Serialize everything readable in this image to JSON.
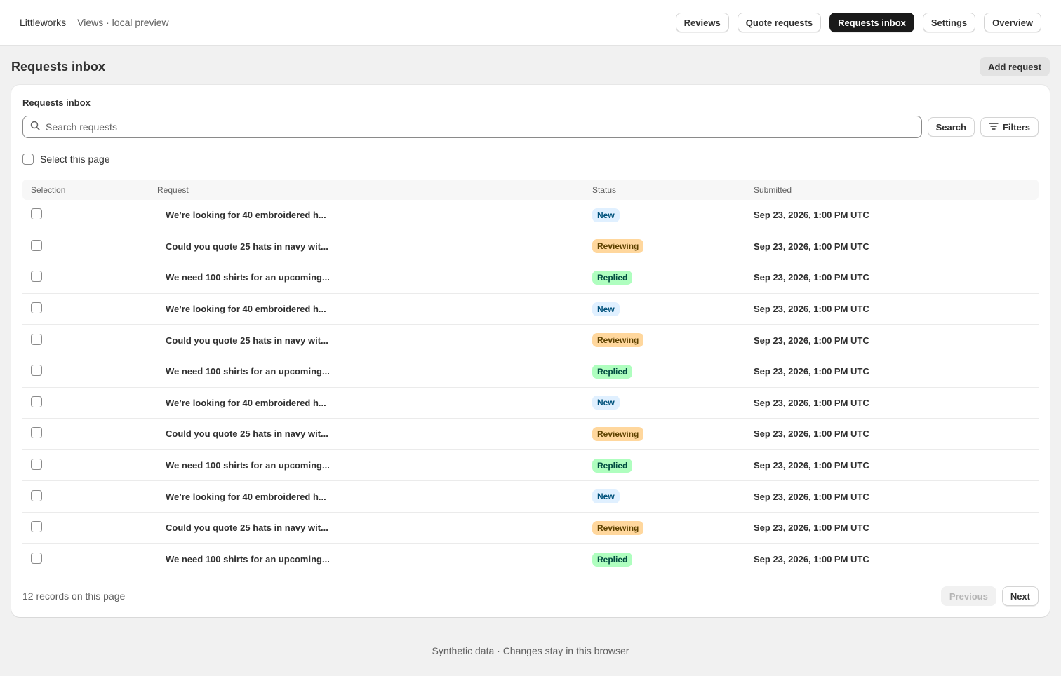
{
  "app": {
    "name": "Littleworks",
    "subtitle": "Views · local preview"
  },
  "nav": [
    {
      "label": "Reviews",
      "active": false
    },
    {
      "label": "Quote requests",
      "active": false
    },
    {
      "label": "Requests inbox",
      "active": true
    },
    {
      "label": "Settings",
      "active": false
    },
    {
      "label": "Overview",
      "active": false
    }
  ],
  "page": {
    "title": "Requests inbox",
    "add_label": "Add request"
  },
  "card": {
    "title": "Requests inbox",
    "search_placeholder": "Search requests",
    "search_label": "Search",
    "filters_label": "Filters",
    "select_page_label": "Select this page"
  },
  "table": {
    "columns": [
      "Selection",
      "Request",
      "Status",
      "Submitted"
    ],
    "rows": [
      {
        "request": "We’re looking for 40 embroidered h...",
        "status": "New",
        "status_kind": "new",
        "submitted": "Sep 23, 2026, 1:00 PM UTC"
      },
      {
        "request": "Could you quote 25 hats in navy wit...",
        "status": "Reviewing",
        "status_kind": "reviewing",
        "submitted": "Sep 23, 2026, 1:00 PM UTC"
      },
      {
        "request": "We need 100 shirts for an upcoming...",
        "status": "Replied",
        "status_kind": "replied",
        "submitted": "Sep 23, 2026, 1:00 PM UTC"
      },
      {
        "request": "We’re looking for 40 embroidered h...",
        "status": "New",
        "status_kind": "new",
        "submitted": "Sep 23, 2026, 1:00 PM UTC"
      },
      {
        "request": "Could you quote 25 hats in navy wit...",
        "status": "Reviewing",
        "status_kind": "reviewing",
        "submitted": "Sep 23, 2026, 1:00 PM UTC"
      },
      {
        "request": "We need 100 shirts for an upcoming...",
        "status": "Replied",
        "status_kind": "replied",
        "submitted": "Sep 23, 2026, 1:00 PM UTC"
      },
      {
        "request": "We’re looking for 40 embroidered h...",
        "status": "New",
        "status_kind": "new",
        "submitted": "Sep 23, 2026, 1:00 PM UTC"
      },
      {
        "request": "Could you quote 25 hats in navy wit...",
        "status": "Reviewing",
        "status_kind": "reviewing",
        "submitted": "Sep 23, 2026, 1:00 PM UTC"
      },
      {
        "request": "We need 100 shirts for an upcoming...",
        "status": "Replied",
        "status_kind": "replied",
        "submitted": "Sep 23, 2026, 1:00 PM UTC"
      },
      {
        "request": "We’re looking for 40 embroidered h...",
        "status": "New",
        "status_kind": "new",
        "submitted": "Sep 23, 2026, 1:00 PM UTC"
      },
      {
        "request": "Could you quote 25 hats in navy wit...",
        "status": "Reviewing",
        "status_kind": "reviewing",
        "submitted": "Sep 23, 2026, 1:00 PM UTC"
      },
      {
        "request": "We need 100 shirts for an upcoming...",
        "status": "Replied",
        "status_kind": "replied",
        "submitted": "Sep 23, 2026, 1:00 PM UTC"
      }
    ]
  },
  "pagination": {
    "records_text": "12 records on this page",
    "previous_label": "Previous",
    "next_label": "Next",
    "previous_disabled": true
  },
  "footer": {
    "text": "Synthetic data · Changes stay in this browser"
  },
  "colors": {
    "active_nav": "#1a1a1a",
    "new_badge": "#e0f0ff",
    "reviewing_badge": "#ffd79d",
    "replied_badge": "#affebf"
  },
  "icons": {
    "search": "search-icon",
    "filters": "filter-icon"
  }
}
